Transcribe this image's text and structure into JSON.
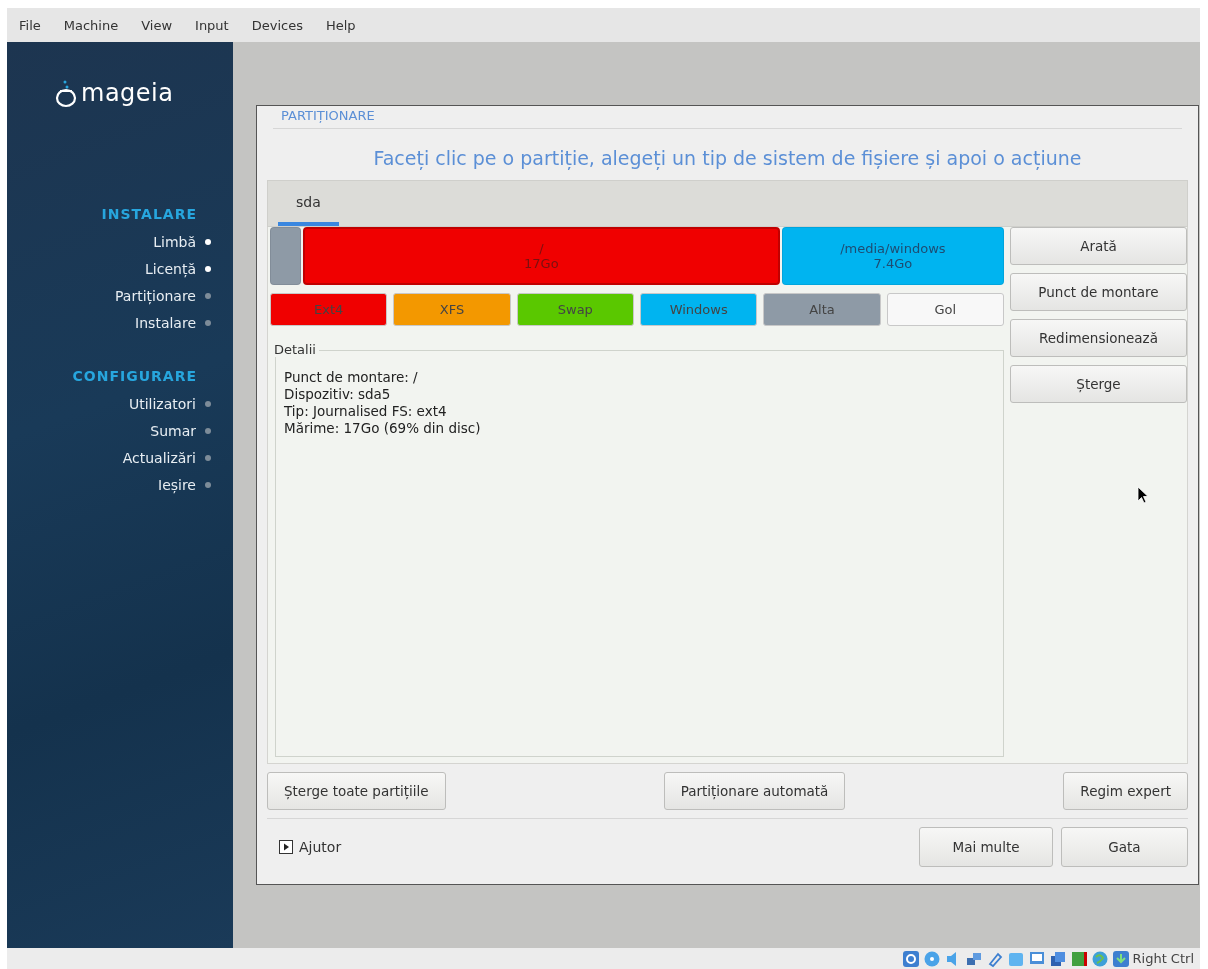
{
  "menu": [
    "File",
    "Machine",
    "View",
    "Input",
    "Devices",
    "Help"
  ],
  "sidebar": {
    "logo_text": "mageia",
    "sections": [
      {
        "title": "INSTALARE",
        "items": [
          {
            "label": "Limbă",
            "done": true
          },
          {
            "label": "Licență",
            "done": true
          },
          {
            "label": "Partiționare",
            "done": false
          },
          {
            "label": "Instalare",
            "done": false
          }
        ]
      },
      {
        "title": "CONFIGURARE",
        "items": [
          {
            "label": "Utilizatori",
            "done": false
          },
          {
            "label": "Sumar",
            "done": false
          },
          {
            "label": "Actualizări",
            "done": false
          },
          {
            "label": "Ieșire",
            "done": false
          }
        ]
      }
    ]
  },
  "dialog": {
    "title": "PARTIȚIONARE",
    "instruction": "Faceți clic pe o partiție, alegeți un tip de sistem de fișiere și apoi o acțiune",
    "tabs": [
      {
        "label": "sda",
        "selected": true
      }
    ],
    "partitions": [
      {
        "color": "#8e9aa6",
        "selected": false
      },
      {
        "mount": "/",
        "size": "17Go",
        "color": "#f00000",
        "selected": true
      },
      {
        "mount": "/media/windows",
        "size": "7.4Go",
        "color": "#00b4f0",
        "selected": false
      }
    ],
    "fs_types": [
      {
        "label": "Ext4",
        "color": "#f00000"
      },
      {
        "label": "XFS",
        "color": "#f39800"
      },
      {
        "label": "Swap",
        "color": "#5ac800"
      },
      {
        "label": "Windows",
        "color": "#00b4f0"
      },
      {
        "label": "Alta",
        "color": "#8e9aa6"
      },
      {
        "label": "Gol",
        "color": "#f8f8f8"
      }
    ],
    "details": {
      "title": "Detalii",
      "lines": [
        "Punct de montare: /",
        "Dispozitiv: sda5",
        "Tip: Journalised FS: ext4",
        "Mărime: 17Go (69% din disc)"
      ]
    },
    "actions": [
      "Arată",
      "Punct de montare",
      "Redimensionează",
      "Șterge"
    ],
    "bottom_buttons": [
      "Șterge toate partițiile",
      "Partiționare automată",
      "Regim expert"
    ],
    "help": "Ajutor",
    "footer_buttons": [
      "Mai multe",
      "Gata"
    ]
  },
  "status_bar": {
    "host_key": "Right Ctrl"
  }
}
